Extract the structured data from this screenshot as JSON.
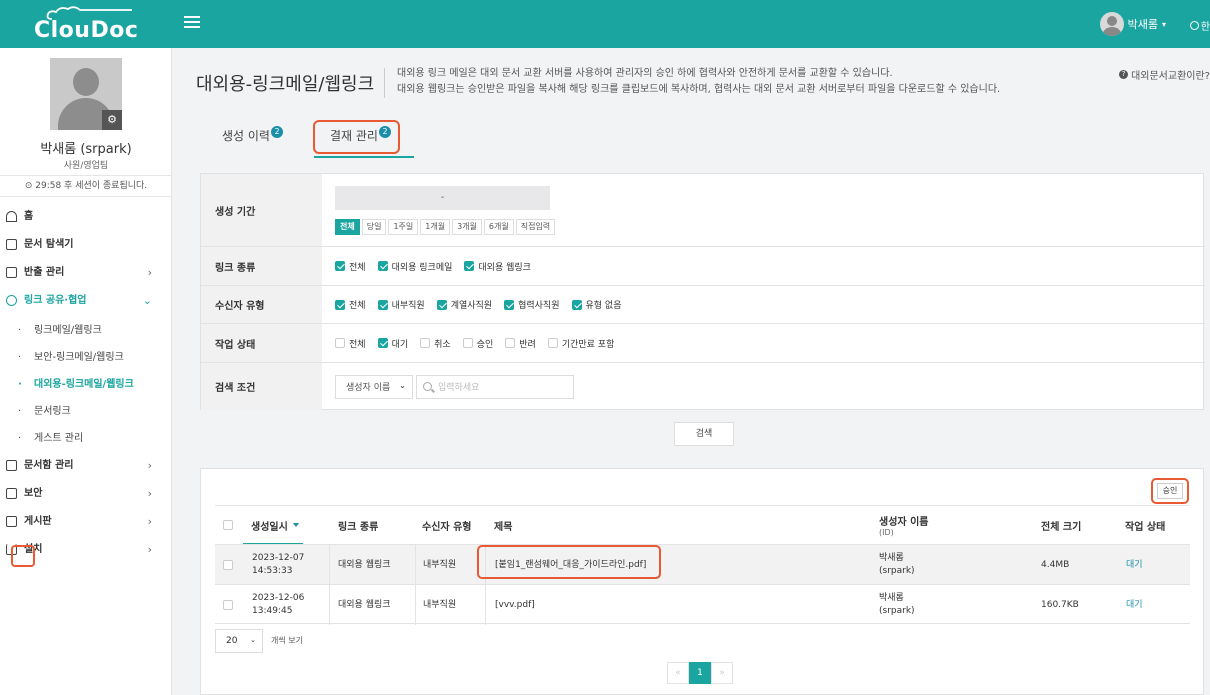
{
  "app": {
    "logo_text": "ClouDoc"
  },
  "header": {
    "user_name": "박새롬",
    "user_caret": "▾",
    "lang_label": "한"
  },
  "profile": {
    "name": "박새롬 (srpark)",
    "dept": "사원/영업팀",
    "session_text": "29:58 후 세션이 종료됩니다."
  },
  "sidebar": {
    "items": [
      {
        "label": "홈"
      },
      {
        "label": "문서 탐색기"
      },
      {
        "label": "반출 관리"
      },
      {
        "label": "링크 공유·협업"
      },
      {
        "label": "문서함 관리"
      },
      {
        "label": "보안"
      },
      {
        "label": "게시판"
      },
      {
        "label": "설치"
      }
    ],
    "sub_items": [
      {
        "label": "링크메일/웹링크"
      },
      {
        "label": "보안-링크메일/웹링크"
      },
      {
        "label": "대외용-링크메일/웹링크"
      },
      {
        "label": "문서링크"
      },
      {
        "label": "게스트 관리"
      }
    ]
  },
  "page": {
    "title": "대외용-링크메일/웹링크",
    "desc_line1": "대외용 링크 메일은 대외 문서 교환 서버를 사용하여 관리자의 승인 하에 협력사와 안전하게 문서를 교환할 수 있습니다.",
    "desc_line2": "대외용 웹링크는 승인받은 파일을 복사해 해당 링크를 클립보드에 복사하며, 협력사는 대외 문서 교환 서버로부터 파일을 다운로드할 수 있습니다.",
    "help_label": "대외문서교환이란?"
  },
  "tabs": [
    {
      "label": "생성 이력",
      "badge": "2"
    },
    {
      "label": "결재 관리",
      "badge": "2"
    }
  ],
  "filter": {
    "period_label": "생성 기간",
    "date_value": "-",
    "period_buttons": [
      "전체",
      "당일",
      "1주일",
      "1개월",
      "3개월",
      "6개월",
      "직접입력"
    ],
    "link_type_label": "링크 종류",
    "link_types": [
      {
        "label": "전체",
        "checked": true
      },
      {
        "label": "대외용 링크메일",
        "checked": true
      },
      {
        "label": "대외용 웹링크",
        "checked": true
      }
    ],
    "recipient_label": "수신자 유형",
    "recipients": [
      {
        "label": "전체",
        "checked": true
      },
      {
        "label": "내부직원",
        "checked": true
      },
      {
        "label": "계열사직원",
        "checked": true
      },
      {
        "label": "협력사직원",
        "checked": true
      },
      {
        "label": "유형 없음",
        "checked": true
      }
    ],
    "status_label": "작업 상태",
    "statuses": [
      {
        "label": "전체",
        "checked": false
      },
      {
        "label": "대기",
        "checked": true
      },
      {
        "label": "취소",
        "checked": false
      },
      {
        "label": "승인",
        "checked": false
      },
      {
        "label": "반려",
        "checked": false
      },
      {
        "label": "기간만료 포함",
        "checked": false
      }
    ],
    "condition_label": "검색 조건",
    "condition_select": "생성자 이름",
    "search_placeholder": "입력하세요"
  },
  "search_button": "검색",
  "results": {
    "approve_button": "승인",
    "columns": {
      "created": "생성일시",
      "link_type": "링크 종류",
      "recipient_type": "수신자 유형",
      "title": "제목",
      "creator": "생성자 이름",
      "creator_sub": "(ID)",
      "size": "전체 크기",
      "status": "작업 상태"
    },
    "rows": [
      {
        "date": "2023-12-07",
        "time": "14:53:33",
        "link_type": "대외용 웹링크",
        "recipient_type": "내부직원",
        "title": "[붙임1_랜섬웨어_대응_가이드라인.pdf]",
        "creator": "박새롬",
        "creator_id": "(srpark)",
        "size": "4.4MB",
        "status": "대기"
      },
      {
        "date": "2023-12-06",
        "time": "13:49:45",
        "link_type": "대외용 웹링크",
        "recipient_type": "내부직원",
        "title": "[vvv.pdf]",
        "creator": "박새롬",
        "creator_id": "(srpark)",
        "size": "160.7KB",
        "status": "대기"
      }
    ],
    "page_size": "20",
    "page_size_label": "개씩 보기",
    "pager": {
      "prev": "«",
      "current": "1",
      "next": "»"
    }
  },
  "colors": {
    "accent": "#1ba5a0",
    "highlight": "#e85a34",
    "link": "#1b8ea8"
  }
}
